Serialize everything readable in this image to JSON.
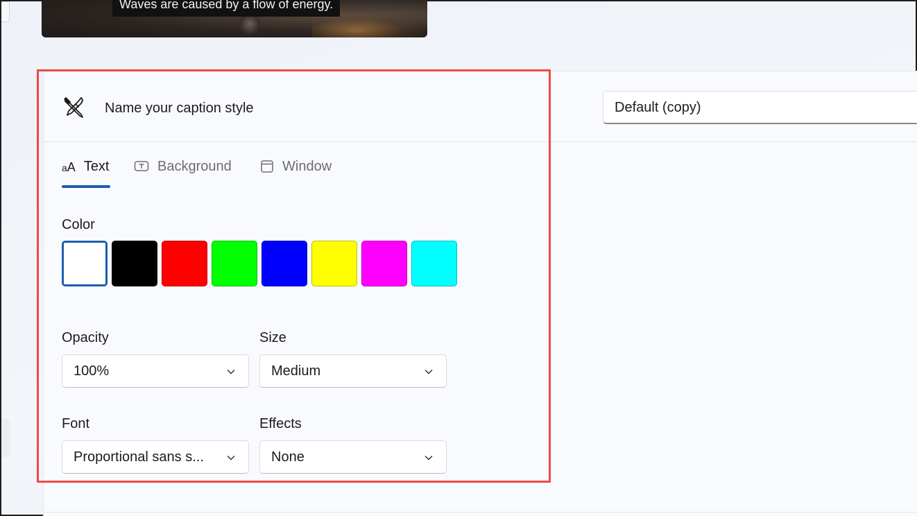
{
  "preview": {
    "caption": "Waves are caused by a flow of energy."
  },
  "style_name": {
    "label": "Name your caption style",
    "value": "Default (copy)"
  },
  "tabs": [
    {
      "label": "Text",
      "icon": "text-size-icon",
      "selected": true
    },
    {
      "label": "Background",
      "icon": "text-box-icon",
      "selected": false
    },
    {
      "label": "Window",
      "icon": "window-icon",
      "selected": false
    }
  ],
  "color": {
    "label": "Color",
    "swatches": [
      "#ffffff",
      "#000000",
      "#ff0000",
      "#00ff00",
      "#0000ff",
      "#ffff00",
      "#ff00ff",
      "#00ffff"
    ],
    "selected_index": 0
  },
  "opacity": {
    "label": "Opacity",
    "value": "100%"
  },
  "size": {
    "label": "Size",
    "value": "Medium"
  },
  "font": {
    "label": "Font",
    "value": "Proportional sans s..."
  },
  "effects": {
    "label": "Effects",
    "value": "None"
  },
  "colors": {
    "accent": "#1a5fae",
    "highlight": "#ee4a44"
  }
}
